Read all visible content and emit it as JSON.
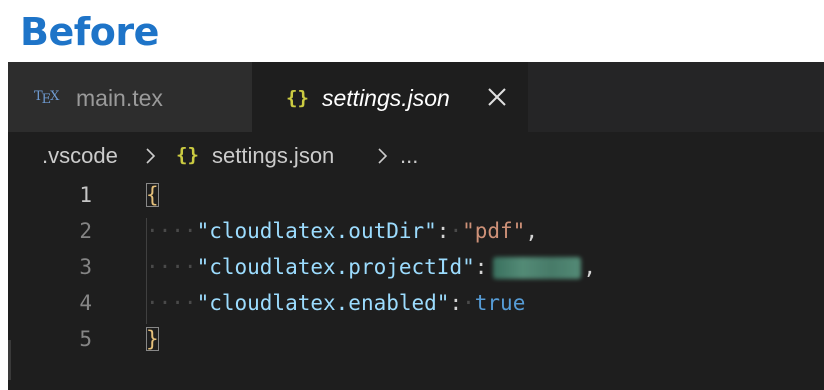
{
  "page": {
    "heading": "Before"
  },
  "tabs": [
    {
      "label": "main.tex",
      "icon": "tex-icon",
      "active": false
    },
    {
      "label": "settings.json",
      "icon": "json-braces-icon",
      "active": true
    }
  ],
  "breadcrumb": {
    "folder": ".vscode",
    "file": "settings.json",
    "more": "..."
  },
  "editor": {
    "line_numbers": [
      "1",
      "2",
      "3",
      "4",
      "5"
    ],
    "lines": [
      {
        "open_brace": "{"
      },
      {
        "key": "\"cloudlatex.outDir\"",
        "colon": ":",
        "value": "\"pdf\"",
        "comma": ","
      },
      {
        "key": "\"cloudlatex.projectId\"",
        "colon": ":",
        "value": "[redacted]",
        "comma": ","
      },
      {
        "key": "\"cloudlatex.enabled\"",
        "colon": ":",
        "value": "true"
      },
      {
        "close_brace": "}"
      }
    ]
  },
  "colors": {
    "heading": "#1e74c8",
    "editor_bg": "#1e1e1e",
    "json_key": "#9cdcfe",
    "json_string": "#ce9178",
    "json_bool": "#569cd6",
    "braces_icon": "#cbcb41"
  }
}
